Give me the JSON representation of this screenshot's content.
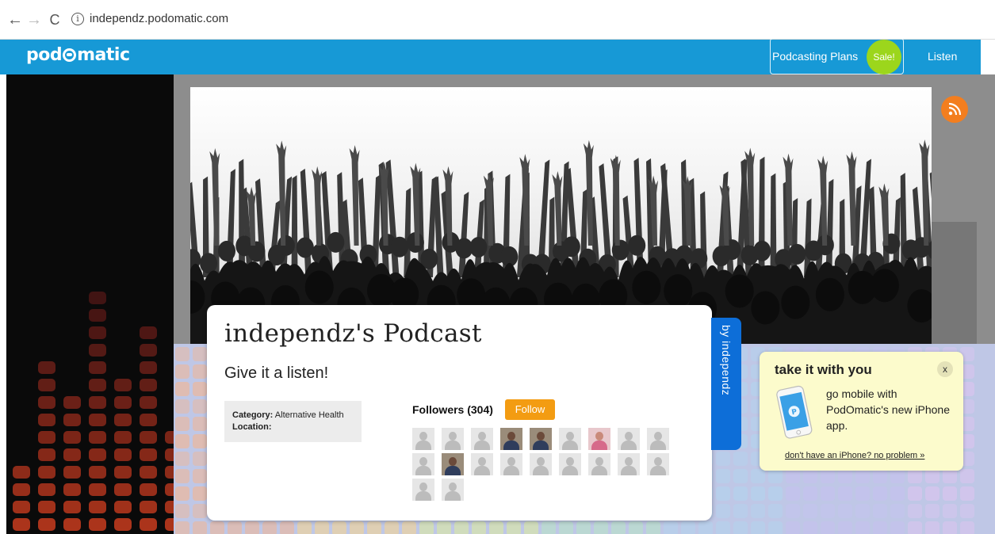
{
  "browser": {
    "url": "independz.podomatic.com",
    "back_icon": "←",
    "forward_icon": "→",
    "reload_icon": "C",
    "info_icon": "i"
  },
  "site_nav": {
    "logo_pre": "pod",
    "logo_post": "matic",
    "plans_label": "Podcasting Plans",
    "sale_badge": "Sale!",
    "listen_label": "Listen"
  },
  "podcast": {
    "title": "independz's Podcast",
    "tagline": "Give it a listen!",
    "category_label": "Category:",
    "category_value": "Alternative Health",
    "location_label": "Location:",
    "location_value": "",
    "followers_label": "Followers (304)",
    "follow_button": "Follow",
    "by_tab": "by independz"
  },
  "mobile_promo": {
    "title": "take it with you",
    "close": "x",
    "description": "go mobile with PodOmatic's new iPhone app.",
    "link": "don't have an iPhone? no problem »"
  },
  "colors": {
    "nav_blue": "#1799d6",
    "follow_orange": "#f39c12",
    "sale_green": "#9cd61c",
    "tab_blue": "#0d6ed8",
    "rss_orange": "#f37e1f"
  }
}
